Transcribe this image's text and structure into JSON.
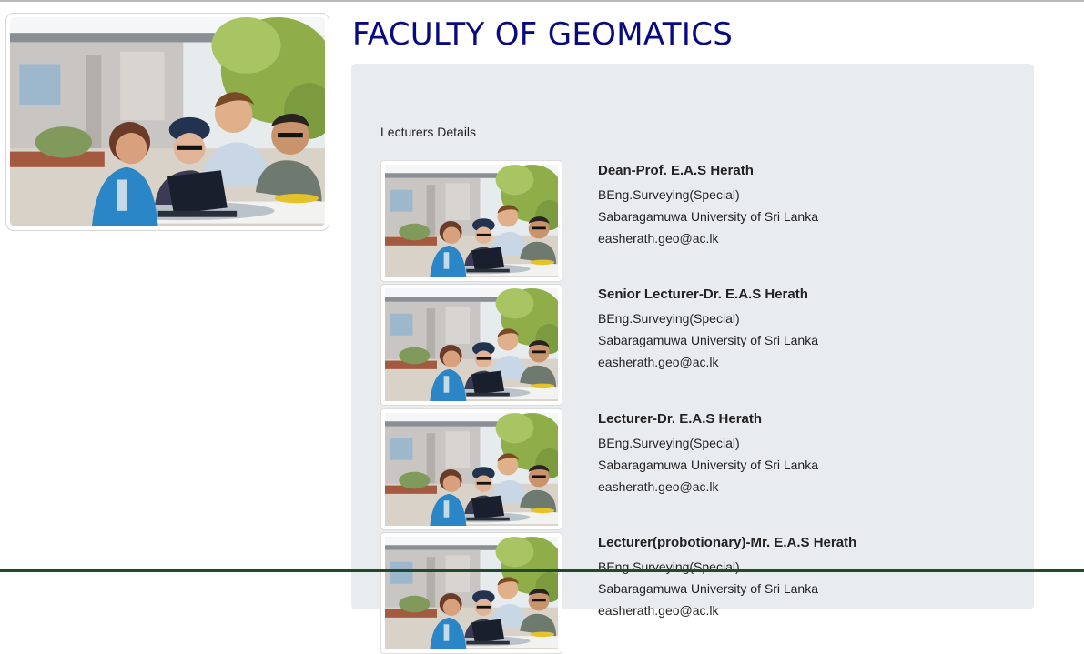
{
  "page": {
    "title": "FACULTY OF GEOMATICS",
    "section_caption": "Lecturers Details"
  },
  "hero": {
    "image": "students-with-laptop-photo"
  },
  "lecturers": [
    {
      "name": "Dean-Prof. E.A.S Herath",
      "degree": "BEng.Surveying(Special)",
      "university": "Sabaragamuwa University of Sri Lanka",
      "email": "easherath.geo@ac.lk"
    },
    {
      "name": "Senior Lecturer-Dr. E.A.S Herath",
      "degree": "BEng.Surveying(Special)",
      "university": "Sabaragamuwa University of Sri Lanka",
      "email": "easherath.geo@ac.lk"
    },
    {
      "name": "Lecturer-Dr. E.A.S Herath",
      "degree": "BEng.Surveying(Special)",
      "university": "Sabaragamuwa University of Sri Lanka",
      "email": "easherath.geo@ac.lk"
    },
    {
      "name": "Lecturer(probotionary)-Mr. E.A.S Herath",
      "degree": "BEng.Surveying(Special)",
      "university": "Sabaragamuwa University of Sri Lanka",
      "email": "easherath.geo@ac.lk"
    }
  ],
  "colors": {
    "title": "#0a0a80",
    "panel_background": "#e9ecef",
    "sky": "#e6ebee",
    "building": "#c9c5c2",
    "foliage": "#8fae4a",
    "shirt": "#2a86c6",
    "laptop": "#1a1f2e"
  }
}
